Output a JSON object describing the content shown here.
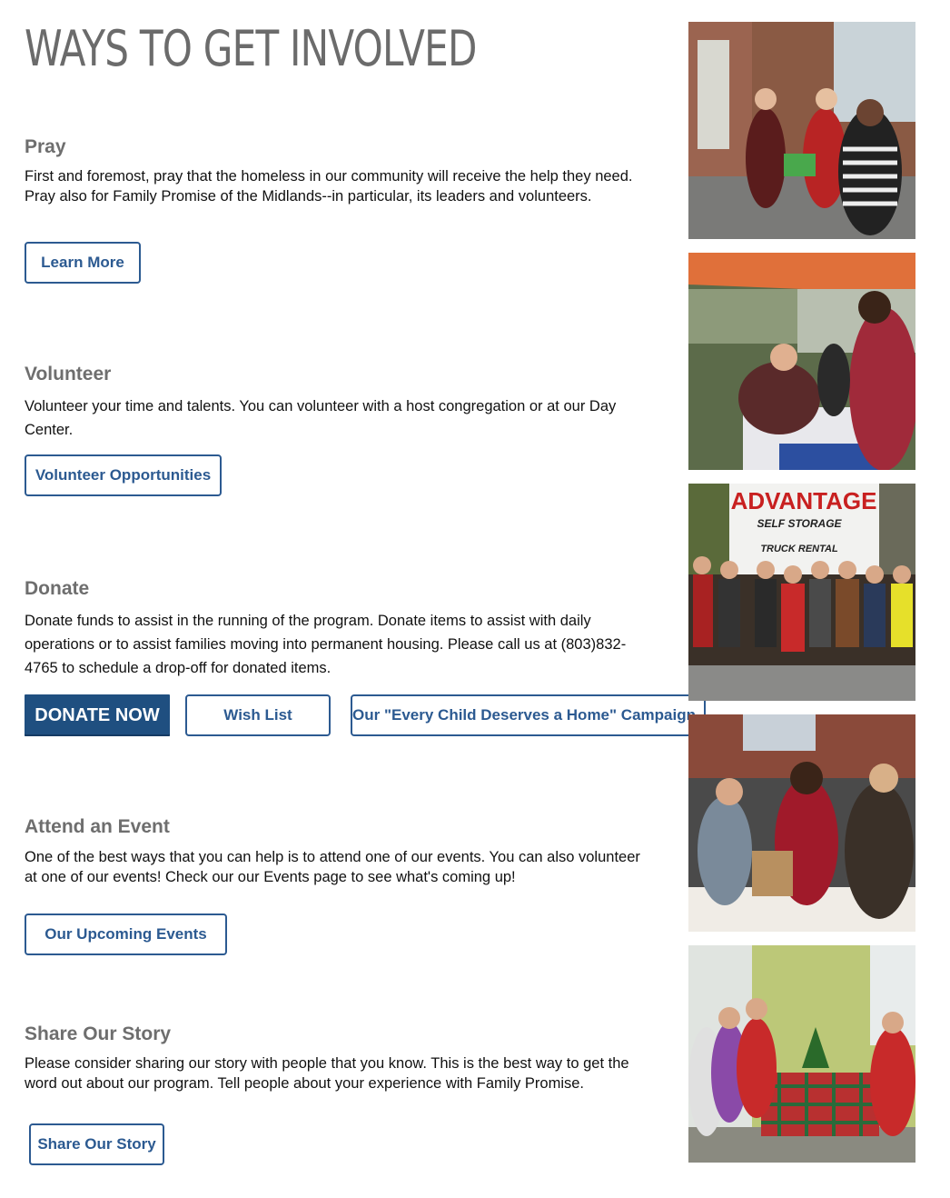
{
  "page_title": "WAYS TO GET INVOLVED",
  "sections": {
    "pray": {
      "heading": "Pray",
      "text": "First and foremost, pray that the homeless in our community will receive the help they need. Pray also for Family Promise of the Midlands--in particular, its leaders and volunteers.",
      "button": "Learn More"
    },
    "volunteer": {
      "heading": "Volunteer",
      "text": "Volunteer your time and talents. You can volunteer with a  host congregation or at our Day Center.",
      "button": "Volunteer Opportunities"
    },
    "donate": {
      "heading": "Donate",
      "text": "Donate funds to assist in the running of the program. Donate items to assist with daily operations or to assist families moving into permanent housing. Please call us at (803)832-4765 to schedule a drop-off for donated items.",
      "donate_button": "DONATE NOW",
      "wishlist_button": "Wish List",
      "campaign_button": "Our \"Every Child Deserves a Home\" Campaign"
    },
    "event": {
      "heading": "Attend an Event",
      "text": "One of the best ways that you can help is to attend one of our events. You can also volunteer at one of our events! Check our our Events page to see what's coming up!",
      "button": "Our Upcoming Events"
    },
    "share": {
      "heading": "Share Our Story",
      "text": "Please consider sharing our story with people that you know. This is the best way to get the word out about our program. Tell people about your experience with Family Promise.",
      "button": "Share Our Story"
    }
  },
  "photos": {
    "sign_line1": "ADVANTAGE",
    "sign_line2": "SELF STORAGE",
    "sign_line3": "TRUCK RENTAL"
  },
  "colors": {
    "accent": "#2c5a91",
    "donate_bg": "#1f4f80",
    "heading": "#6e6e6e"
  }
}
